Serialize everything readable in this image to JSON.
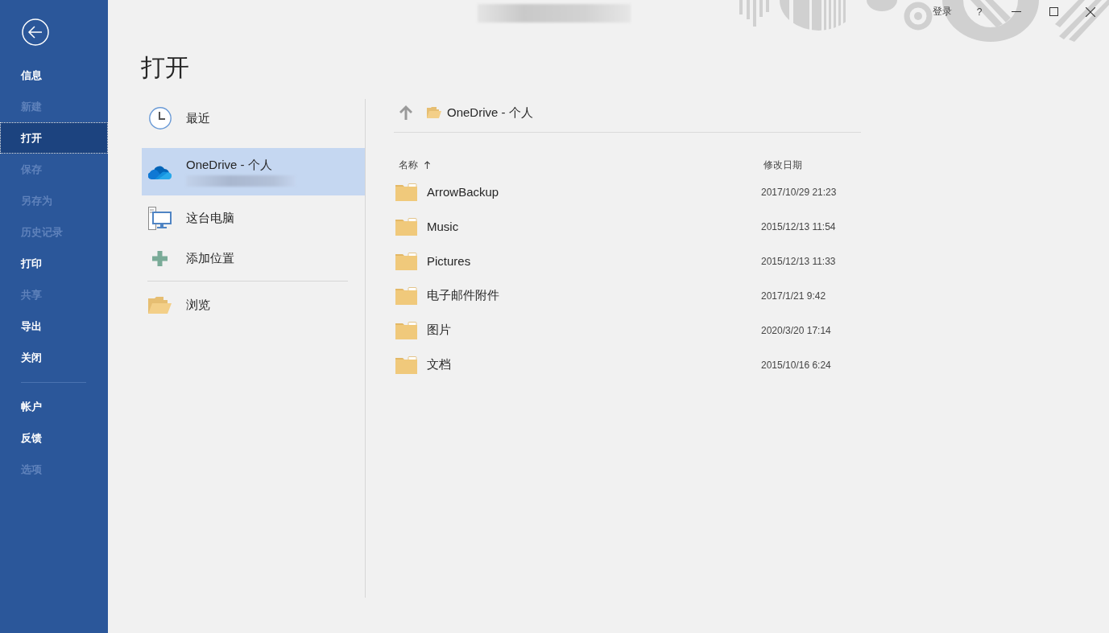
{
  "title_bar": {
    "sign_in": "登录",
    "help": "?"
  },
  "sidebar": {
    "items": [
      {
        "label": "信息",
        "disabled": false,
        "selected": false
      },
      {
        "label": "新建",
        "disabled": true,
        "selected": false
      },
      {
        "label": "打开",
        "disabled": false,
        "selected": true
      },
      {
        "label": "保存",
        "disabled": true,
        "selected": false
      },
      {
        "label": "另存为",
        "disabled": true,
        "selected": false
      },
      {
        "label": "历史记录",
        "disabled": true,
        "selected": false
      },
      {
        "label": "打印",
        "disabled": false,
        "selected": false
      },
      {
        "label": "共享",
        "disabled": true,
        "selected": false
      },
      {
        "label": "导出",
        "disabled": false,
        "selected": false
      },
      {
        "label": "关闭",
        "disabled": false,
        "selected": false
      }
    ],
    "footer_items": [
      {
        "label": "帐户",
        "disabled": false,
        "selected": false
      },
      {
        "label": "反馈",
        "disabled": false,
        "selected": false
      },
      {
        "label": "选项",
        "disabled": true,
        "selected": false
      }
    ]
  },
  "page": {
    "title": "打开"
  },
  "locations": {
    "items": [
      {
        "kind": "recent",
        "label": "最近",
        "selected": false
      },
      {
        "kind": "onedrive",
        "label": "OneDrive - 个人",
        "selected": true
      },
      {
        "kind": "computer",
        "label": "这台电脑",
        "selected": false
      },
      {
        "kind": "add",
        "label": "添加位置",
        "selected": false
      }
    ],
    "browse": {
      "label": "浏览"
    }
  },
  "browser": {
    "path": "OneDrive - 个人",
    "columns": [
      {
        "label": "名称",
        "sorted": true
      },
      {
        "label": "修改日期",
        "sorted": false
      }
    ],
    "rows": [
      {
        "name": "ArrowBackup",
        "modified": "2017/10/29 21:23"
      },
      {
        "name": "Music",
        "modified": "2015/12/13 11:54"
      },
      {
        "name": "Pictures",
        "modified": "2015/12/13 11:33"
      },
      {
        "name": "电子邮件附件",
        "modified": "2017/1/21 9:42"
      },
      {
        "name": "图片",
        "modified": "2020/3/20 17:14"
      },
      {
        "name": "文档",
        "modified": "2015/10/16 6:24"
      }
    ]
  }
}
